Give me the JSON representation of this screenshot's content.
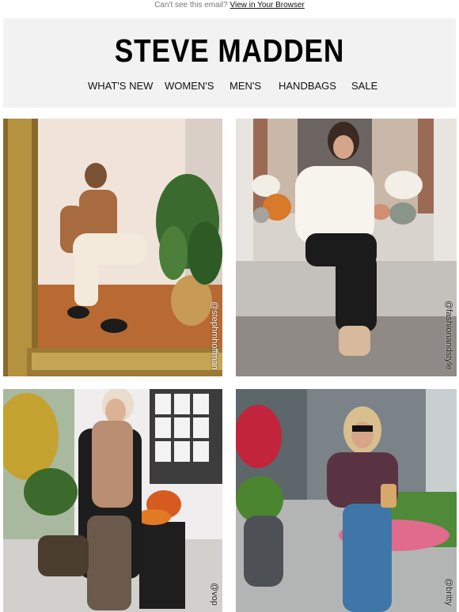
{
  "topbar": {
    "prefix": "Can't see this email?",
    "link": "View in Your Browser"
  },
  "brand": {
    "logo_text": "STEVE MADDEN"
  },
  "nav": [
    "WHAT'S NEW",
    "WOMEN'S",
    "MEN'S",
    "HANDBAGS",
    "SALE"
  ],
  "photos": [
    {
      "handle": "@stephmhoffman"
    },
    {
      "handle": "@fashionandstyle"
    },
    {
      "handle": "@vop"
    },
    {
      "handle": "@britty"
    }
  ],
  "colors": {
    "background": "#ffffff",
    "header_bg": "#f2f2f2",
    "text": "#111111"
  }
}
